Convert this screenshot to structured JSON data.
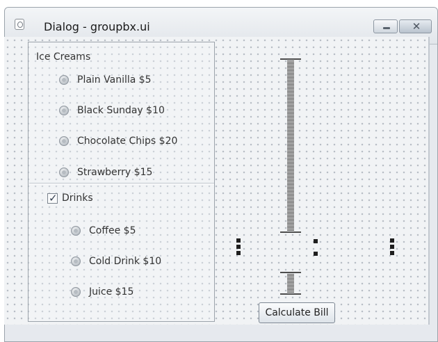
{
  "window": {
    "title": "Dialog - groupbx.ui",
    "close_glyph": "✕"
  },
  "ice_creams": {
    "title": "Ice Creams",
    "items": [
      {
        "label": "Plain Vanilla  $5"
      },
      {
        "label": "Black Sunday $10"
      },
      {
        "label": "Chocolate Chips  $20"
      },
      {
        "label": "Strawberry  $15"
      }
    ]
  },
  "drinks": {
    "label": "Drinks",
    "checked": true,
    "check_glyph": "✓",
    "items": [
      {
        "label": "Coffee  $5"
      },
      {
        "label": "Cold Drink $10"
      },
      {
        "label": "Juice $15"
      }
    ]
  },
  "actions": {
    "calculate_label": "Calculate Bill"
  }
}
